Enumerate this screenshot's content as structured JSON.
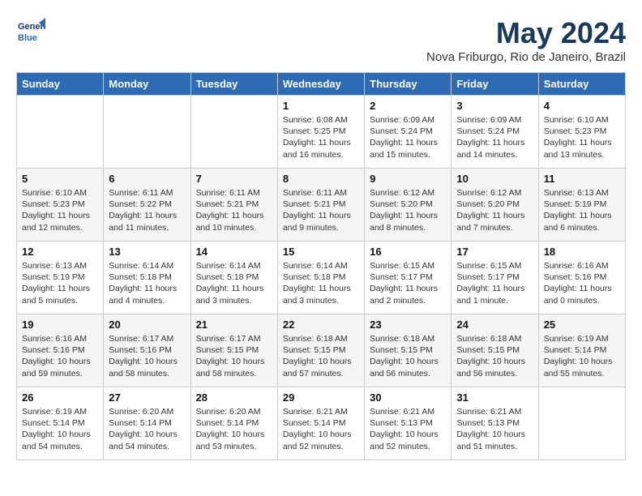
{
  "header": {
    "logo_line1": "General",
    "logo_line2": "Blue",
    "month_title": "May 2024",
    "location": "Nova Friburgo, Rio de Janeiro, Brazil"
  },
  "days_of_week": [
    "Sunday",
    "Monday",
    "Tuesday",
    "Wednesday",
    "Thursday",
    "Friday",
    "Saturday"
  ],
  "weeks": [
    [
      {
        "day": "",
        "info": ""
      },
      {
        "day": "",
        "info": ""
      },
      {
        "day": "",
        "info": ""
      },
      {
        "day": "1",
        "info": "Sunrise: 6:08 AM\nSunset: 5:25 PM\nDaylight: 11 hours\nand 16 minutes."
      },
      {
        "day": "2",
        "info": "Sunrise: 6:09 AM\nSunset: 5:24 PM\nDaylight: 11 hours\nand 15 minutes."
      },
      {
        "day": "3",
        "info": "Sunrise: 6:09 AM\nSunset: 5:24 PM\nDaylight: 11 hours\nand 14 minutes."
      },
      {
        "day": "4",
        "info": "Sunrise: 6:10 AM\nSunset: 5:23 PM\nDaylight: 11 hours\nand 13 minutes."
      }
    ],
    [
      {
        "day": "5",
        "info": "Sunrise: 6:10 AM\nSunset: 5:23 PM\nDaylight: 11 hours\nand 12 minutes."
      },
      {
        "day": "6",
        "info": "Sunrise: 6:11 AM\nSunset: 5:22 PM\nDaylight: 11 hours\nand 11 minutes."
      },
      {
        "day": "7",
        "info": "Sunrise: 6:11 AM\nSunset: 5:21 PM\nDaylight: 11 hours\nand 10 minutes."
      },
      {
        "day": "8",
        "info": "Sunrise: 6:11 AM\nSunset: 5:21 PM\nDaylight: 11 hours\nand 9 minutes."
      },
      {
        "day": "9",
        "info": "Sunrise: 6:12 AM\nSunset: 5:20 PM\nDaylight: 11 hours\nand 8 minutes."
      },
      {
        "day": "10",
        "info": "Sunrise: 6:12 AM\nSunset: 5:20 PM\nDaylight: 11 hours\nand 7 minutes."
      },
      {
        "day": "11",
        "info": "Sunrise: 6:13 AM\nSunset: 5:19 PM\nDaylight: 11 hours\nand 6 minutes."
      }
    ],
    [
      {
        "day": "12",
        "info": "Sunrise: 6:13 AM\nSunset: 5:19 PM\nDaylight: 11 hours\nand 5 minutes."
      },
      {
        "day": "13",
        "info": "Sunrise: 6:14 AM\nSunset: 5:18 PM\nDaylight: 11 hours\nand 4 minutes."
      },
      {
        "day": "14",
        "info": "Sunrise: 6:14 AM\nSunset: 5:18 PM\nDaylight: 11 hours\nand 3 minutes."
      },
      {
        "day": "15",
        "info": "Sunrise: 6:14 AM\nSunset: 5:18 PM\nDaylight: 11 hours\nand 3 minutes."
      },
      {
        "day": "16",
        "info": "Sunrise: 6:15 AM\nSunset: 5:17 PM\nDaylight: 11 hours\nand 2 minutes."
      },
      {
        "day": "17",
        "info": "Sunrise: 6:15 AM\nSunset: 5:17 PM\nDaylight: 11 hours\nand 1 minute."
      },
      {
        "day": "18",
        "info": "Sunrise: 6:16 AM\nSunset: 5:16 PM\nDaylight: 11 hours\nand 0 minutes."
      }
    ],
    [
      {
        "day": "19",
        "info": "Sunrise: 6:16 AM\nSunset: 5:16 PM\nDaylight: 10 hours\nand 59 minutes."
      },
      {
        "day": "20",
        "info": "Sunrise: 6:17 AM\nSunset: 5:16 PM\nDaylight: 10 hours\nand 58 minutes."
      },
      {
        "day": "21",
        "info": "Sunrise: 6:17 AM\nSunset: 5:15 PM\nDaylight: 10 hours\nand 58 minutes."
      },
      {
        "day": "22",
        "info": "Sunrise: 6:18 AM\nSunset: 5:15 PM\nDaylight: 10 hours\nand 57 minutes."
      },
      {
        "day": "23",
        "info": "Sunrise: 6:18 AM\nSunset: 5:15 PM\nDaylight: 10 hours\nand 56 minutes."
      },
      {
        "day": "24",
        "info": "Sunrise: 6:18 AM\nSunset: 5:15 PM\nDaylight: 10 hours\nand 56 minutes."
      },
      {
        "day": "25",
        "info": "Sunrise: 6:19 AM\nSunset: 5:14 PM\nDaylight: 10 hours\nand 55 minutes."
      }
    ],
    [
      {
        "day": "26",
        "info": "Sunrise: 6:19 AM\nSunset: 5:14 PM\nDaylight: 10 hours\nand 54 minutes."
      },
      {
        "day": "27",
        "info": "Sunrise: 6:20 AM\nSunset: 5:14 PM\nDaylight: 10 hours\nand 54 minutes."
      },
      {
        "day": "28",
        "info": "Sunrise: 6:20 AM\nSunset: 5:14 PM\nDaylight: 10 hours\nand 53 minutes."
      },
      {
        "day": "29",
        "info": "Sunrise: 6:21 AM\nSunset: 5:14 PM\nDaylight: 10 hours\nand 52 minutes."
      },
      {
        "day": "30",
        "info": "Sunrise: 6:21 AM\nSunset: 5:13 PM\nDaylight: 10 hours\nand 52 minutes."
      },
      {
        "day": "31",
        "info": "Sunrise: 6:21 AM\nSunset: 5:13 PM\nDaylight: 10 hours\nand 51 minutes."
      },
      {
        "day": "",
        "info": ""
      }
    ]
  ]
}
